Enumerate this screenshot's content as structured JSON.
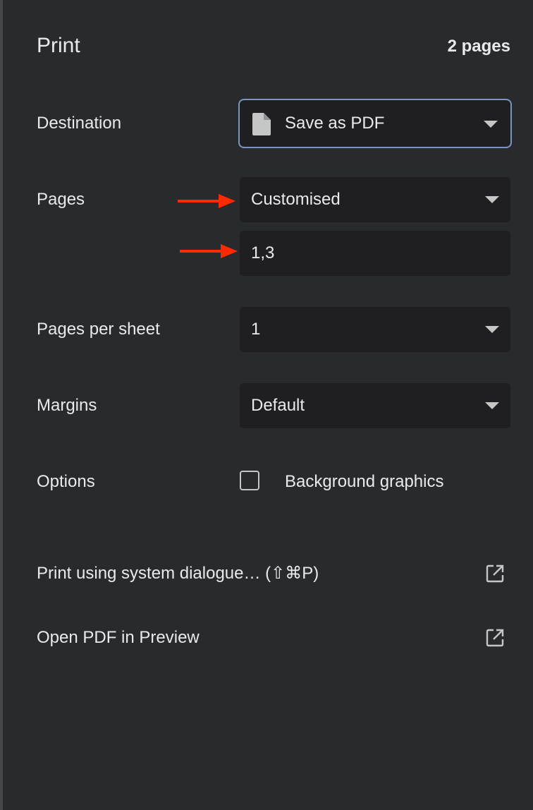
{
  "header": {
    "title": "Print",
    "page_count": "2 pages"
  },
  "destination": {
    "label": "Destination",
    "value": "Save as PDF",
    "icon": "document-icon"
  },
  "pages": {
    "label": "Pages",
    "value": "Customised",
    "custom_range": "1,3"
  },
  "pages_per_sheet": {
    "label": "Pages per sheet",
    "value": "1"
  },
  "margins": {
    "label": "Margins",
    "value": "Default"
  },
  "options": {
    "label": "Options",
    "background_graphics_label": "Background graphics",
    "background_graphics_checked": false
  },
  "links": [
    {
      "label": "Print using system dialogue… (⇧⌘P)",
      "icon": "open-external-icon"
    },
    {
      "label": "Open PDF in Preview",
      "icon": "open-external-icon"
    }
  ],
  "colors": {
    "background": "#292a2d",
    "control_background": "#1f1f21",
    "text": "#e8eaed",
    "focus_border": "#7a96bd",
    "annotation_arrow": "#ff2a00"
  }
}
